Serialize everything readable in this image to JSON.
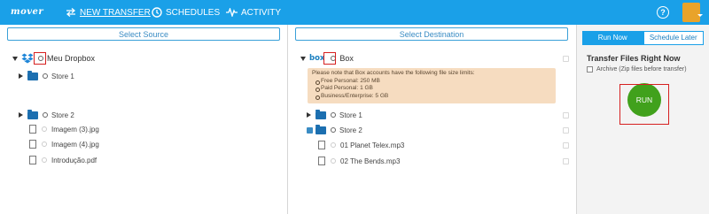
{
  "header": {
    "logo": "mover",
    "nav": [
      {
        "label": "NEW TRANSFER",
        "icon": "transfer-arrows-icon"
      },
      {
        "label": "SCHEDULES",
        "icon": "clock-icon"
      },
      {
        "label": "ACTIVITY",
        "icon": "pulse-icon"
      }
    ],
    "help_icon": "?",
    "brand_color": "#1aa0e8"
  },
  "source": {
    "button_label": "Select Source",
    "root_label": "Meu Dropbox",
    "items": [
      {
        "label": "Store 1",
        "type": "folder"
      },
      {
        "label": "Store 2",
        "type": "folder"
      },
      {
        "label": "Imagem (3).jpg",
        "type": "file"
      },
      {
        "label": "Imagem (4).jpg",
        "type": "file"
      },
      {
        "label": "Introdução.pdf",
        "type": "file"
      }
    ]
  },
  "destination": {
    "button_label": "Select Destination",
    "root_label": "Box",
    "root_logo": "box",
    "notice": {
      "intro": "Please note that Box accounts have the following file size limits:",
      "limits": [
        "Free Personal: 250 MB",
        "Paid Personal: 1 GB",
        "Business/Enterprise: 5 GB"
      ]
    },
    "items": [
      {
        "label": "Store 1",
        "type": "folder"
      },
      {
        "label": "Store 2",
        "type": "folder"
      },
      {
        "label": "01 Planet Telex.mp3",
        "type": "file"
      },
      {
        "label": "02 The Bends.mp3",
        "type": "file"
      }
    ]
  },
  "run_panel": {
    "tabs": [
      "Run Now",
      "Schedule Later"
    ],
    "title": "Transfer Files Right Now",
    "archive_label": "Archive (Zip files before transfer)",
    "run_label": "RUN",
    "run_color": "#41a11c",
    "highlight_color": "#d62020"
  }
}
